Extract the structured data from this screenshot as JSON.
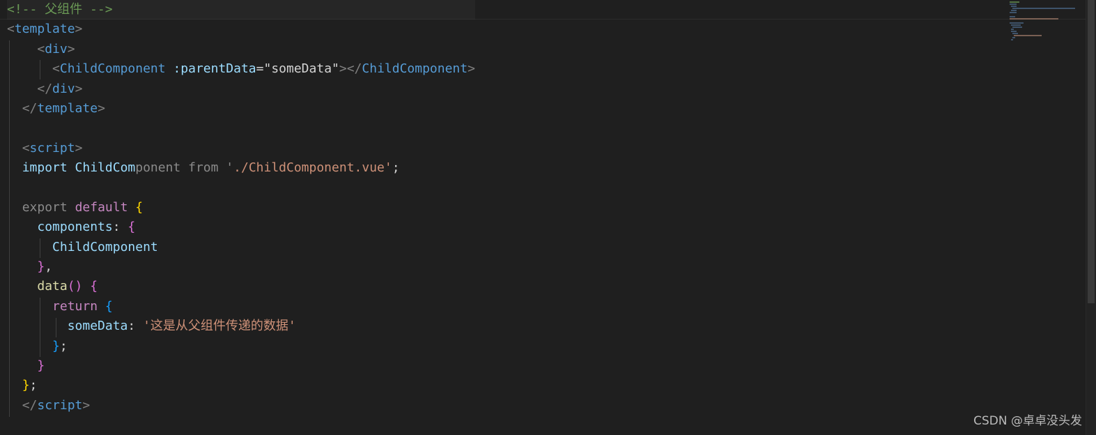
{
  "editor": {
    "lines": [
      {
        "tokens": [
          {
            "t": "<!-- 父组件 -->",
            "c": "c-comment"
          }
        ]
      },
      {
        "tokens": [
          {
            "t": "<",
            "c": "c-bracket"
          },
          {
            "t": "template",
            "c": "c-tag"
          },
          {
            "t": ">",
            "c": "c-bracket"
          }
        ]
      },
      {
        "tokens": [
          {
            "t": "    ",
            "c": ""
          },
          {
            "t": "<",
            "c": "c-bracket"
          },
          {
            "t": "div",
            "c": "c-tag"
          },
          {
            "t": ">",
            "c": "c-bracket"
          }
        ]
      },
      {
        "tokens": [
          {
            "t": "      ",
            "c": ""
          },
          {
            "t": "<",
            "c": "c-bracket"
          },
          {
            "t": "ChildComponent",
            "c": "c-tag"
          },
          {
            "t": " ",
            "c": ""
          },
          {
            "t": ":parentData",
            "c": "c-attr"
          },
          {
            "t": "=",
            "c": "c-eq"
          },
          {
            "t": "\"someData\"",
            "c": "c-white"
          },
          {
            "t": "></",
            "c": "c-bracket"
          },
          {
            "t": "ChildComponent",
            "c": "c-tag"
          },
          {
            "t": ">",
            "c": "c-bracket"
          }
        ]
      },
      {
        "tokens": [
          {
            "t": "    ",
            "c": ""
          },
          {
            "t": "</",
            "c": "c-bracket"
          },
          {
            "t": "div",
            "c": "c-tag"
          },
          {
            "t": ">",
            "c": "c-bracket"
          }
        ]
      },
      {
        "tokens": [
          {
            "t": "  ",
            "c": ""
          },
          {
            "t": "</",
            "c": "c-bracket"
          },
          {
            "t": "template",
            "c": "c-tag"
          },
          {
            "t": ">",
            "c": "c-bracket"
          }
        ]
      },
      {
        "tokens": [
          {
            "t": "",
            "c": ""
          }
        ]
      },
      {
        "tokens": [
          {
            "t": "  ",
            "c": ""
          },
          {
            "t": "<",
            "c": "c-bracket"
          },
          {
            "t": "script",
            "c": "c-tag"
          },
          {
            "t": ">",
            "c": "c-bracket"
          }
        ]
      },
      {
        "tokens": [
          {
            "t": "  ",
            "c": ""
          },
          {
            "t": "import ",
            "c": "c-var"
          },
          {
            "t": "ChildCom",
            "c": "c-var"
          },
          {
            "t": "ponent from '",
            "c": "c-dim"
          },
          {
            "t": "./Child",
            "c": "c-str"
          },
          {
            "t": "Component.vue",
            "c": "c-str"
          },
          {
            "t": "'",
            "c": "c-str"
          },
          {
            "t": ";",
            "c": "c-white"
          }
        ]
      },
      {
        "tokens": [
          {
            "t": "",
            "c": ""
          }
        ]
      },
      {
        "tokens": [
          {
            "t": "  ",
            "c": ""
          },
          {
            "t": "export",
            "c": "c-dim"
          },
          {
            "t": " ",
            "c": ""
          },
          {
            "t": "default",
            "c": "c-kw"
          },
          {
            "t": " ",
            "c": ""
          },
          {
            "t": "{",
            "c": "c-y"
          }
        ]
      },
      {
        "tokens": [
          {
            "t": "    ",
            "c": ""
          },
          {
            "t": "components",
            "c": "c-var"
          },
          {
            "t": ": ",
            "c": "c-white"
          },
          {
            "t": "{",
            "c": "c-p"
          }
        ]
      },
      {
        "tokens": [
          {
            "t": "      ",
            "c": ""
          },
          {
            "t": "ChildComponent",
            "c": "c-var"
          }
        ]
      },
      {
        "tokens": [
          {
            "t": "    ",
            "c": ""
          },
          {
            "t": "}",
            "c": "c-p"
          },
          {
            "t": ",",
            "c": "c-white"
          }
        ]
      },
      {
        "tokens": [
          {
            "t": "    ",
            "c": ""
          },
          {
            "t": "data",
            "c": "c-fn"
          },
          {
            "t": "()",
            "c": "c-p"
          },
          {
            "t": " ",
            "c": ""
          },
          {
            "t": "{",
            "c": "c-p"
          }
        ]
      },
      {
        "tokens": [
          {
            "t": "      ",
            "c": ""
          },
          {
            "t": "return",
            "c": "c-kw"
          },
          {
            "t": " ",
            "c": ""
          },
          {
            "t": "{",
            "c": "c-b"
          }
        ]
      },
      {
        "tokens": [
          {
            "t": "        ",
            "c": ""
          },
          {
            "t": "someData",
            "c": "c-var"
          },
          {
            "t": ": ",
            "c": "c-white"
          },
          {
            "t": "'这是从父组件传递的数据'",
            "c": "c-str"
          }
        ]
      },
      {
        "tokens": [
          {
            "t": "      ",
            "c": ""
          },
          {
            "t": "}",
            "c": "c-b"
          },
          {
            "t": ";",
            "c": "c-white"
          }
        ]
      },
      {
        "tokens": [
          {
            "t": "    ",
            "c": ""
          },
          {
            "t": "}",
            "c": "c-p"
          }
        ]
      },
      {
        "tokens": [
          {
            "t": "  ",
            "c": ""
          },
          {
            "t": "}",
            "c": "c-y"
          },
          {
            "t": ";",
            "c": "c-white"
          }
        ]
      },
      {
        "tokens": [
          {
            "t": "  ",
            "c": ""
          },
          {
            "t": "</",
            "c": "c-bracket"
          },
          {
            "t": "script",
            "c": "c-tag"
          },
          {
            "t": ">",
            "c": "c-bracket"
          }
        ]
      }
    ]
  },
  "watermark": "CSDN @卓卓没头发",
  "colors": {
    "background": "#1f1f1f",
    "comment": "#6a9955",
    "tag": "#569cd6",
    "attribute": "#9cdcfe",
    "string": "#ce9178",
    "keyword": "#c586c0",
    "function": "#dcdcaa",
    "bracket_gold": "#ffd700",
    "bracket_orchid": "#da70d6",
    "bracket_blue": "#179fff"
  }
}
